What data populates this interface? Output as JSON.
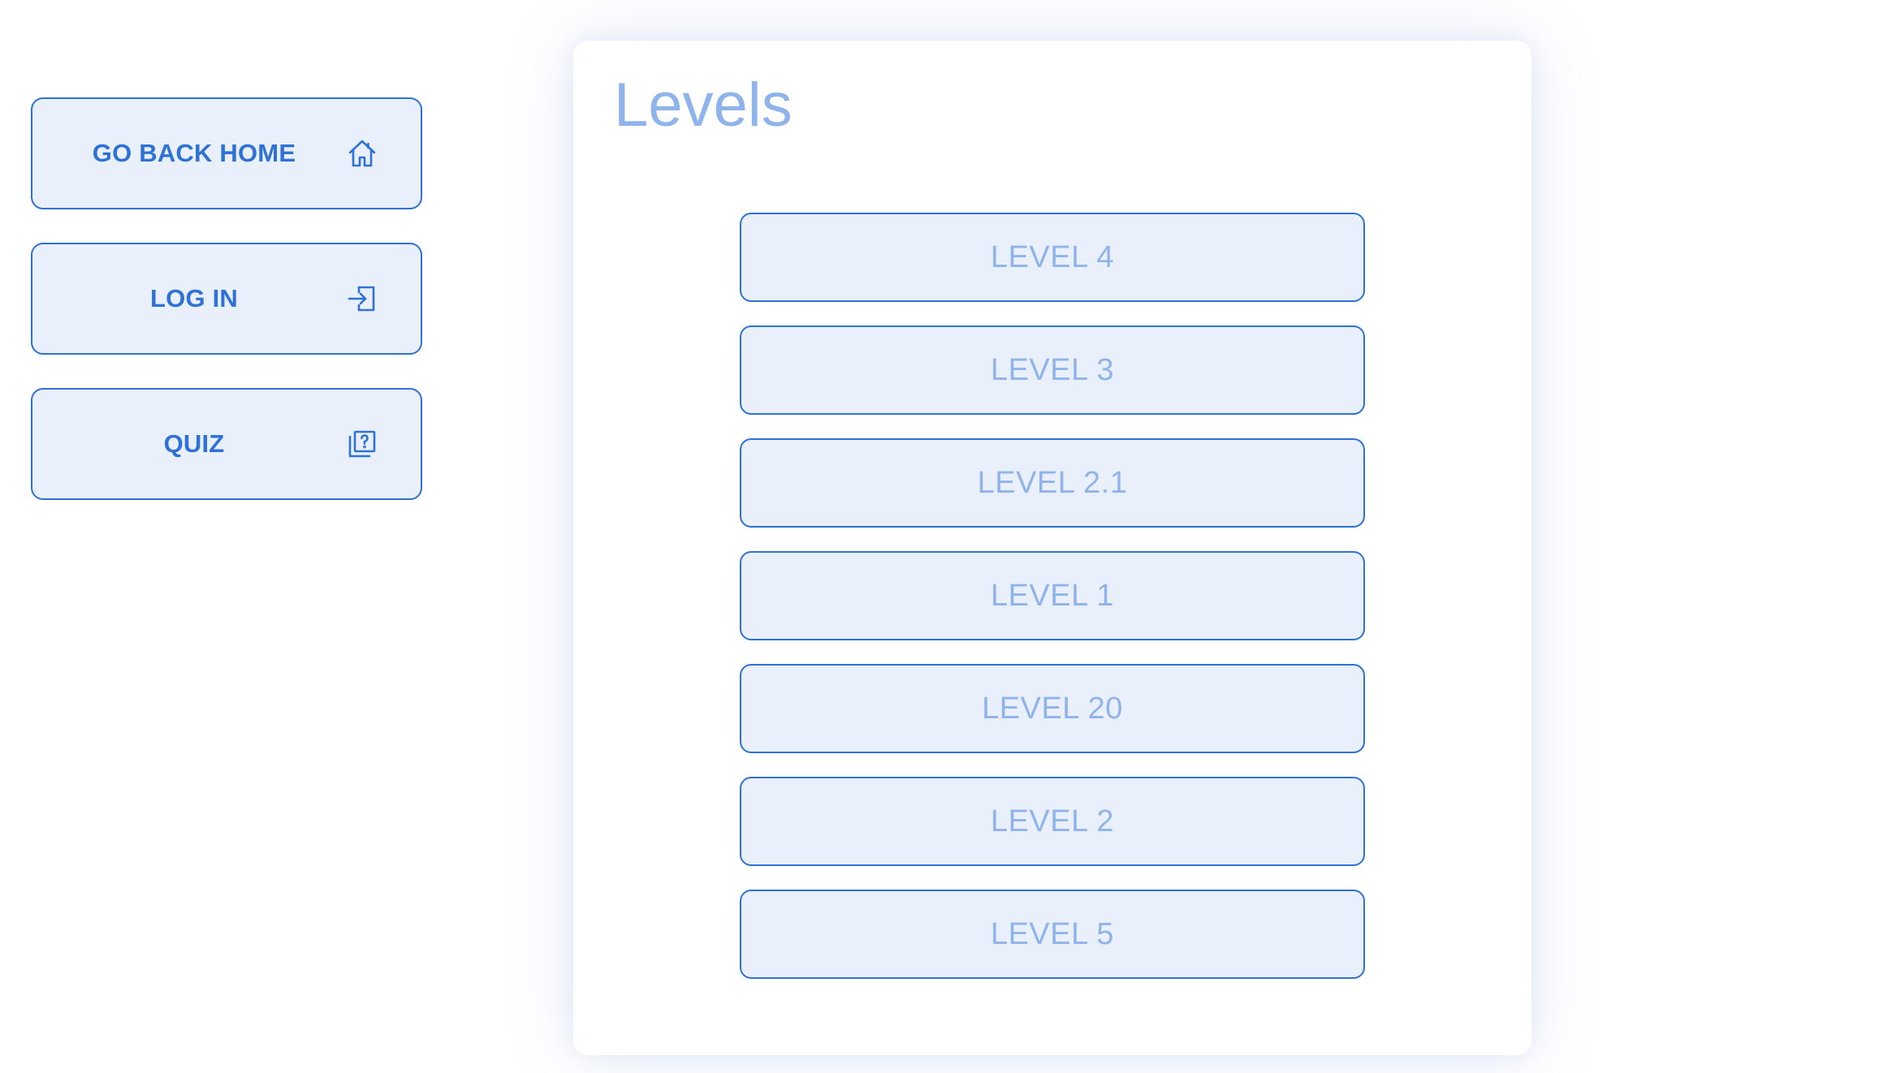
{
  "sidebar": {
    "items": [
      {
        "label": "GO BACK HOME",
        "icon": "home-icon"
      },
      {
        "label": "LOG IN",
        "icon": "login-icon"
      },
      {
        "label": "QUIZ",
        "icon": "quiz-icon"
      }
    ]
  },
  "levels": {
    "title": "Levels",
    "items": [
      {
        "label": "LEVEL 4"
      },
      {
        "label": "LEVEL 3"
      },
      {
        "label": "LEVEL 2.1"
      },
      {
        "label": "LEVEL 1"
      },
      {
        "label": "LEVEL 20"
      },
      {
        "label": "LEVEL 2"
      },
      {
        "label": "LEVEL 5"
      }
    ]
  },
  "colors": {
    "accent": "#2f72d6",
    "button_fill": "#eaf0fb",
    "muted_text": "#8fb4ec",
    "background": "#ffffff"
  }
}
